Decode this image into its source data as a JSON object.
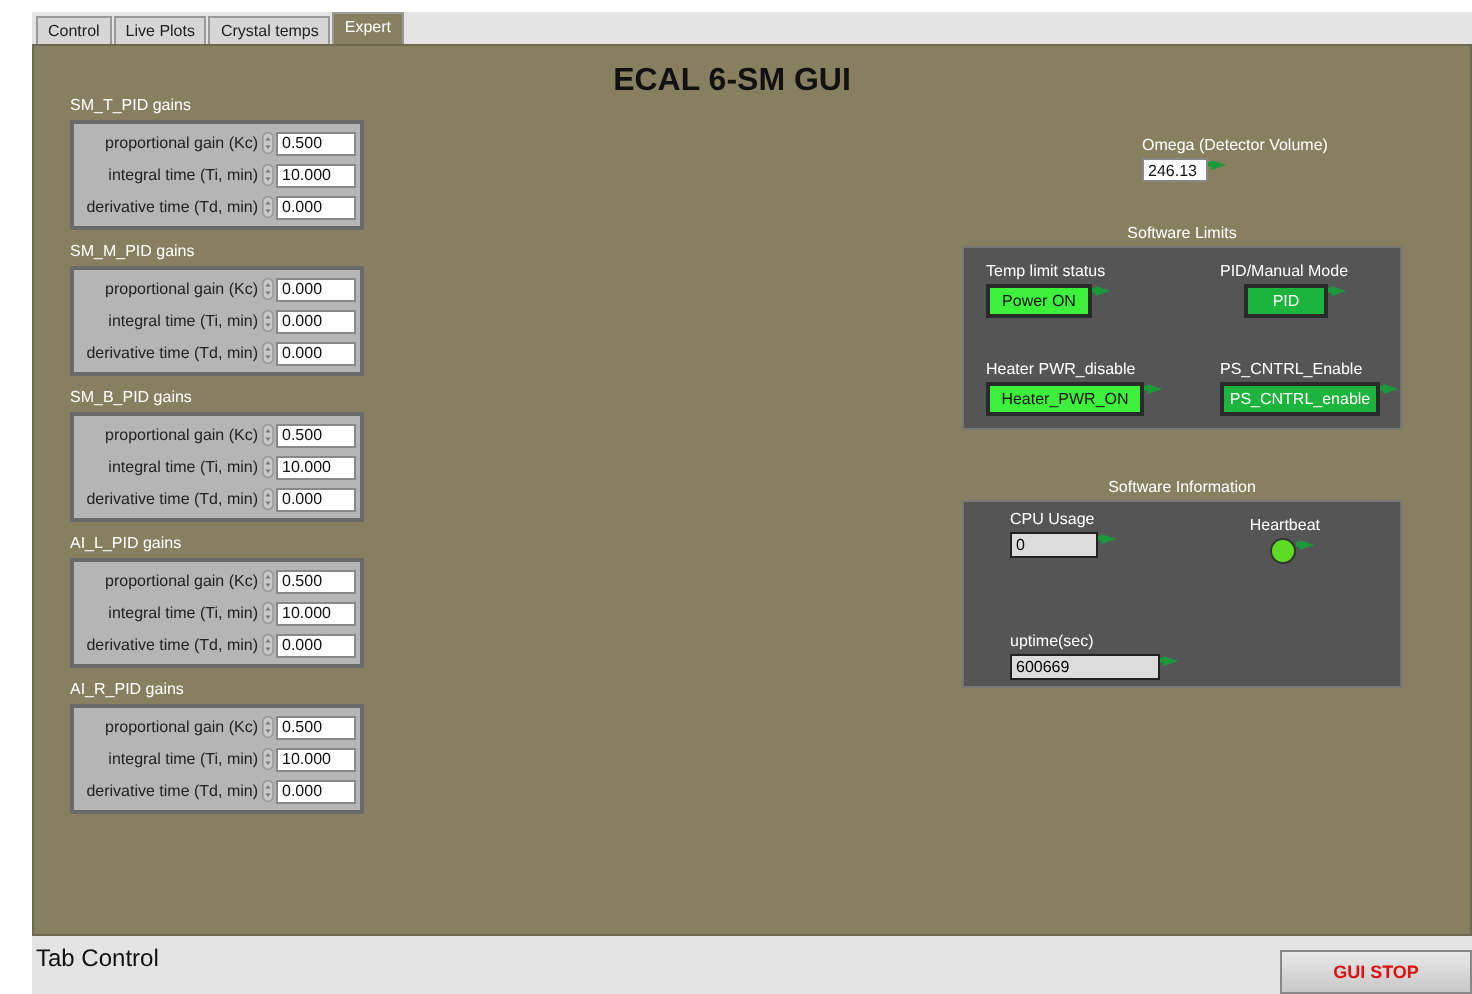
{
  "tabs": [
    {
      "label": "Control",
      "selected": false
    },
    {
      "label": "Live Plots",
      "selected": false
    },
    {
      "label": "Crystal temps",
      "selected": false
    },
    {
      "label": "Expert",
      "selected": true
    }
  ],
  "title": "ECAL 6-SM GUI",
  "pid_groups": [
    {
      "heading": "SM_T_PID gains",
      "rows": [
        {
          "label": "proportional gain (Kc)",
          "value": "0.500"
        },
        {
          "label": "integral time (Ti, min)",
          "value": "10.000"
        },
        {
          "label": "derivative time (Td, min)",
          "value": "0.000"
        }
      ]
    },
    {
      "heading": "SM_M_PID gains",
      "rows": [
        {
          "label": "proportional gain (Kc)",
          "value": "0.000"
        },
        {
          "label": "integral time (Ti, min)",
          "value": "0.000"
        },
        {
          "label": "derivative time (Td, min)",
          "value": "0.000"
        }
      ]
    },
    {
      "heading": "SM_B_PID gains",
      "rows": [
        {
          "label": "proportional gain (Kc)",
          "value": "0.500"
        },
        {
          "label": "integral time (Ti, min)",
          "value": "10.000"
        },
        {
          "label": "derivative time (Td, min)",
          "value": "0.000"
        }
      ]
    },
    {
      "heading": "AI_L_PID gains",
      "rows": [
        {
          "label": "proportional gain (Kc)",
          "value": "0.500"
        },
        {
          "label": "integral time (Ti, min)",
          "value": "10.000"
        },
        {
          "label": "derivative time (Td, min)",
          "value": "0.000"
        }
      ]
    },
    {
      "heading": "AI_R_PID gains",
      "rows": [
        {
          "label": "proportional gain (Kc)",
          "value": "0.500"
        },
        {
          "label": "integral time (Ti, min)",
          "value": "10.000"
        },
        {
          "label": "derivative time (Td, min)",
          "value": "0.000"
        }
      ]
    }
  ],
  "omega": {
    "label": "Omega (Detector Volume)",
    "value": "246.13"
  },
  "software_limits": {
    "heading": "Software Limits",
    "switches": [
      {
        "label": "Temp limit status",
        "text": "Power ON",
        "on": true
      },
      {
        "label": "PID/Manual Mode",
        "text": "PID",
        "on": true
      },
      {
        "label": "Heater PWR_disable",
        "text": "Heater_PWR_ON",
        "on": true
      },
      {
        "label": "PS_CNTRL_Enable",
        "text": "PS_CNTRL_enable",
        "on": true
      }
    ]
  },
  "software_information": {
    "heading": "Software Information",
    "cpu_usage": {
      "label": "CPU Usage",
      "value": "0"
    },
    "heartbeat": {
      "label": "Heartbeat",
      "on": true
    },
    "uptime": {
      "label": "uptime(sec)",
      "value": "600669"
    }
  },
  "status_bar": {
    "label": "Tab Control",
    "stop_button": "GUI STOP"
  }
}
